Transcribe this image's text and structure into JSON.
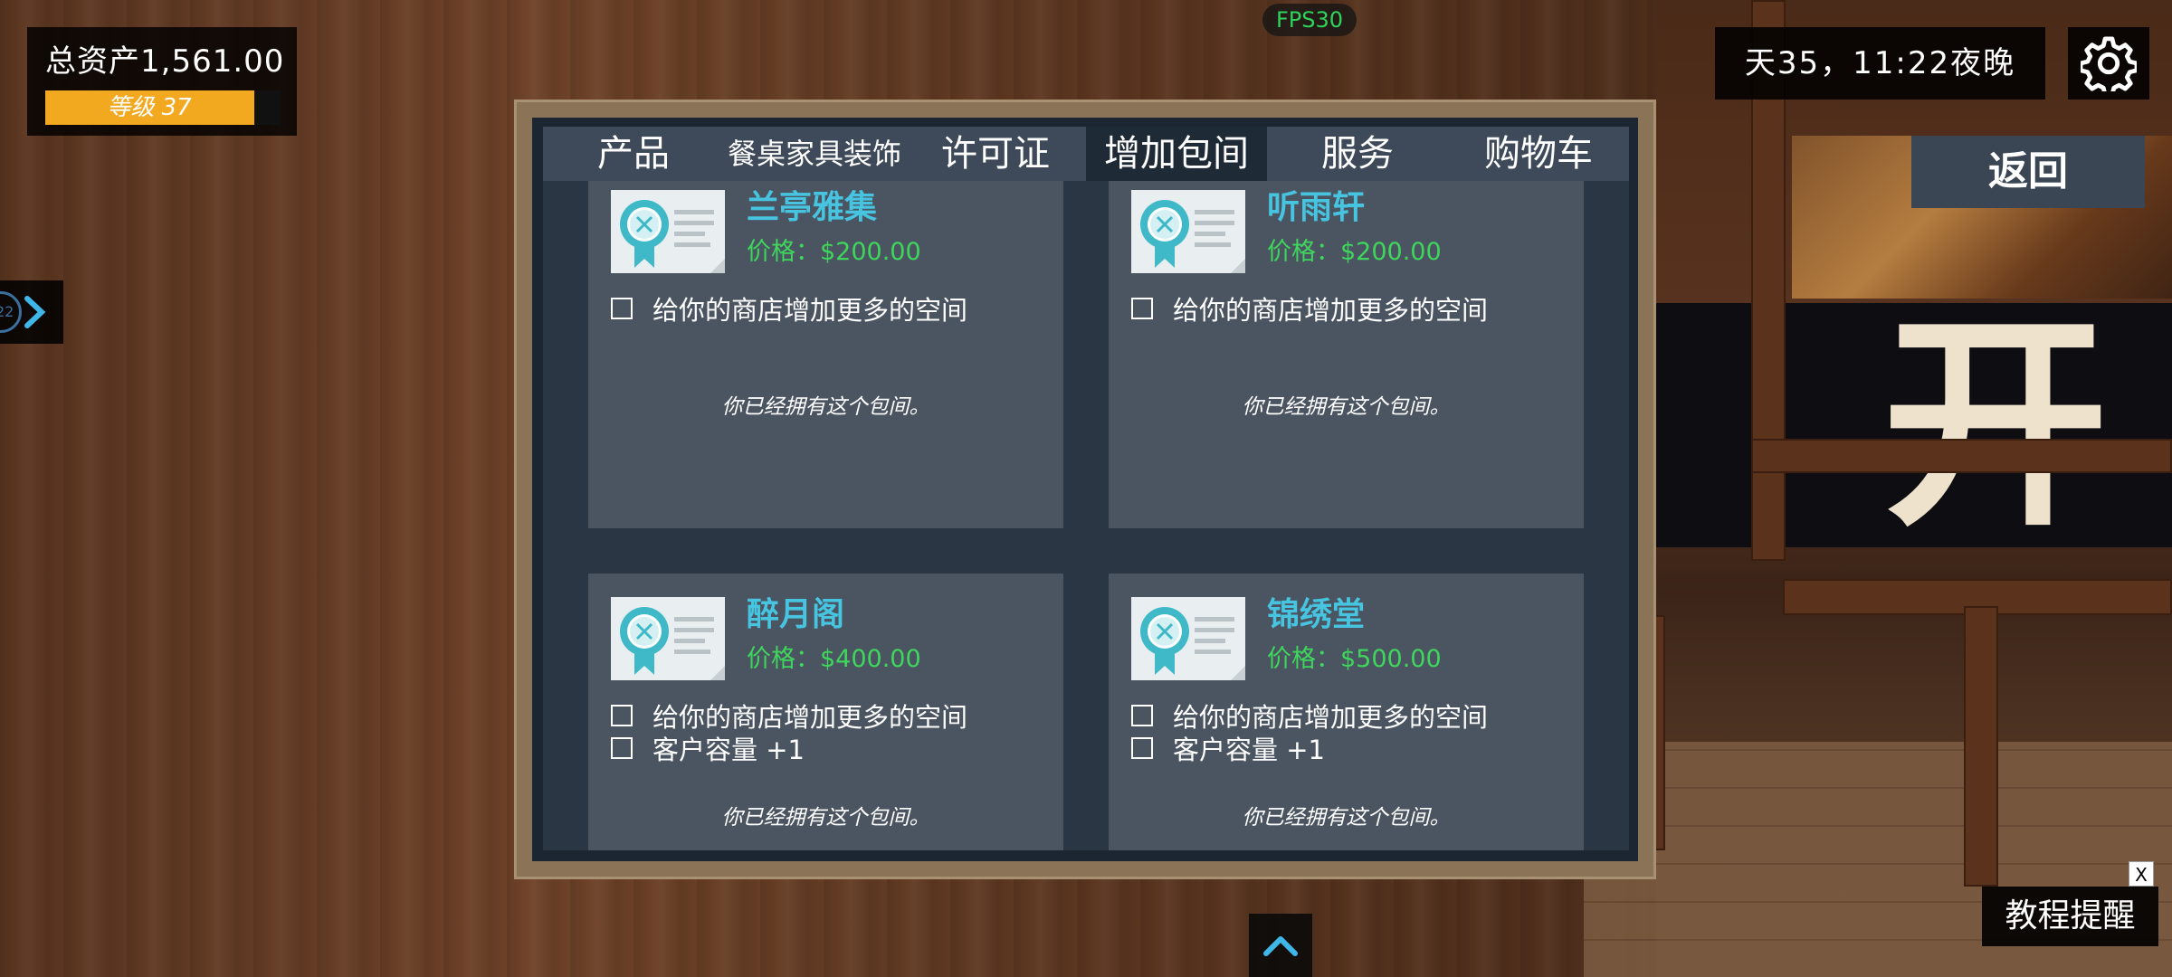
{
  "hud": {
    "assets_label": "总资产1,561.00",
    "level_label": "等级 37",
    "level_fill_fraction": 0.89,
    "fps": "FPS30",
    "time": "天35，11:22夜晚",
    "return_label": "返回",
    "handle_number": "22",
    "tutorial_label": "教程提醒",
    "tutorial_close": "X"
  },
  "background": {
    "sign_text": "开"
  },
  "tabs": [
    {
      "label": "产品",
      "active": false
    },
    {
      "label": "餐桌家具装饰",
      "active": false
    },
    {
      "label": "许可证",
      "active": false
    },
    {
      "label": "增加包间",
      "active": true
    },
    {
      "label": "服务",
      "active": false
    },
    {
      "label": "购物车",
      "active": false
    }
  ],
  "rooms": [
    {
      "name": "兰亭雅集",
      "price": "价格：$200.00",
      "features": [
        "给你的商店增加更多的空间"
      ],
      "status": "你已经拥有这个包间。"
    },
    {
      "name": "听雨轩",
      "price": "价格：$200.00",
      "features": [
        "给你的商店增加更多的空间"
      ],
      "status": "你已经拥有这个包间。"
    },
    {
      "name": "醉月阁",
      "price": "价格：$400.00",
      "features": [
        "给你的商店增加更多的空间",
        "客户容量 +1"
      ],
      "status": "你已经拥有这个包间。"
    },
    {
      "name": "锦绣堂",
      "price": "价格：$500.00",
      "features": [
        "给你的商店增加更多的空间",
        "客户容量 +1"
      ],
      "status": "你已经拥有这个包间。"
    }
  ],
  "colors": {
    "room_title": "#46c4e0",
    "price": "#3ed65c",
    "level_bar": "#f2a81f",
    "fps": "#2fd35b",
    "up_arrow": "#3fb6e8"
  }
}
